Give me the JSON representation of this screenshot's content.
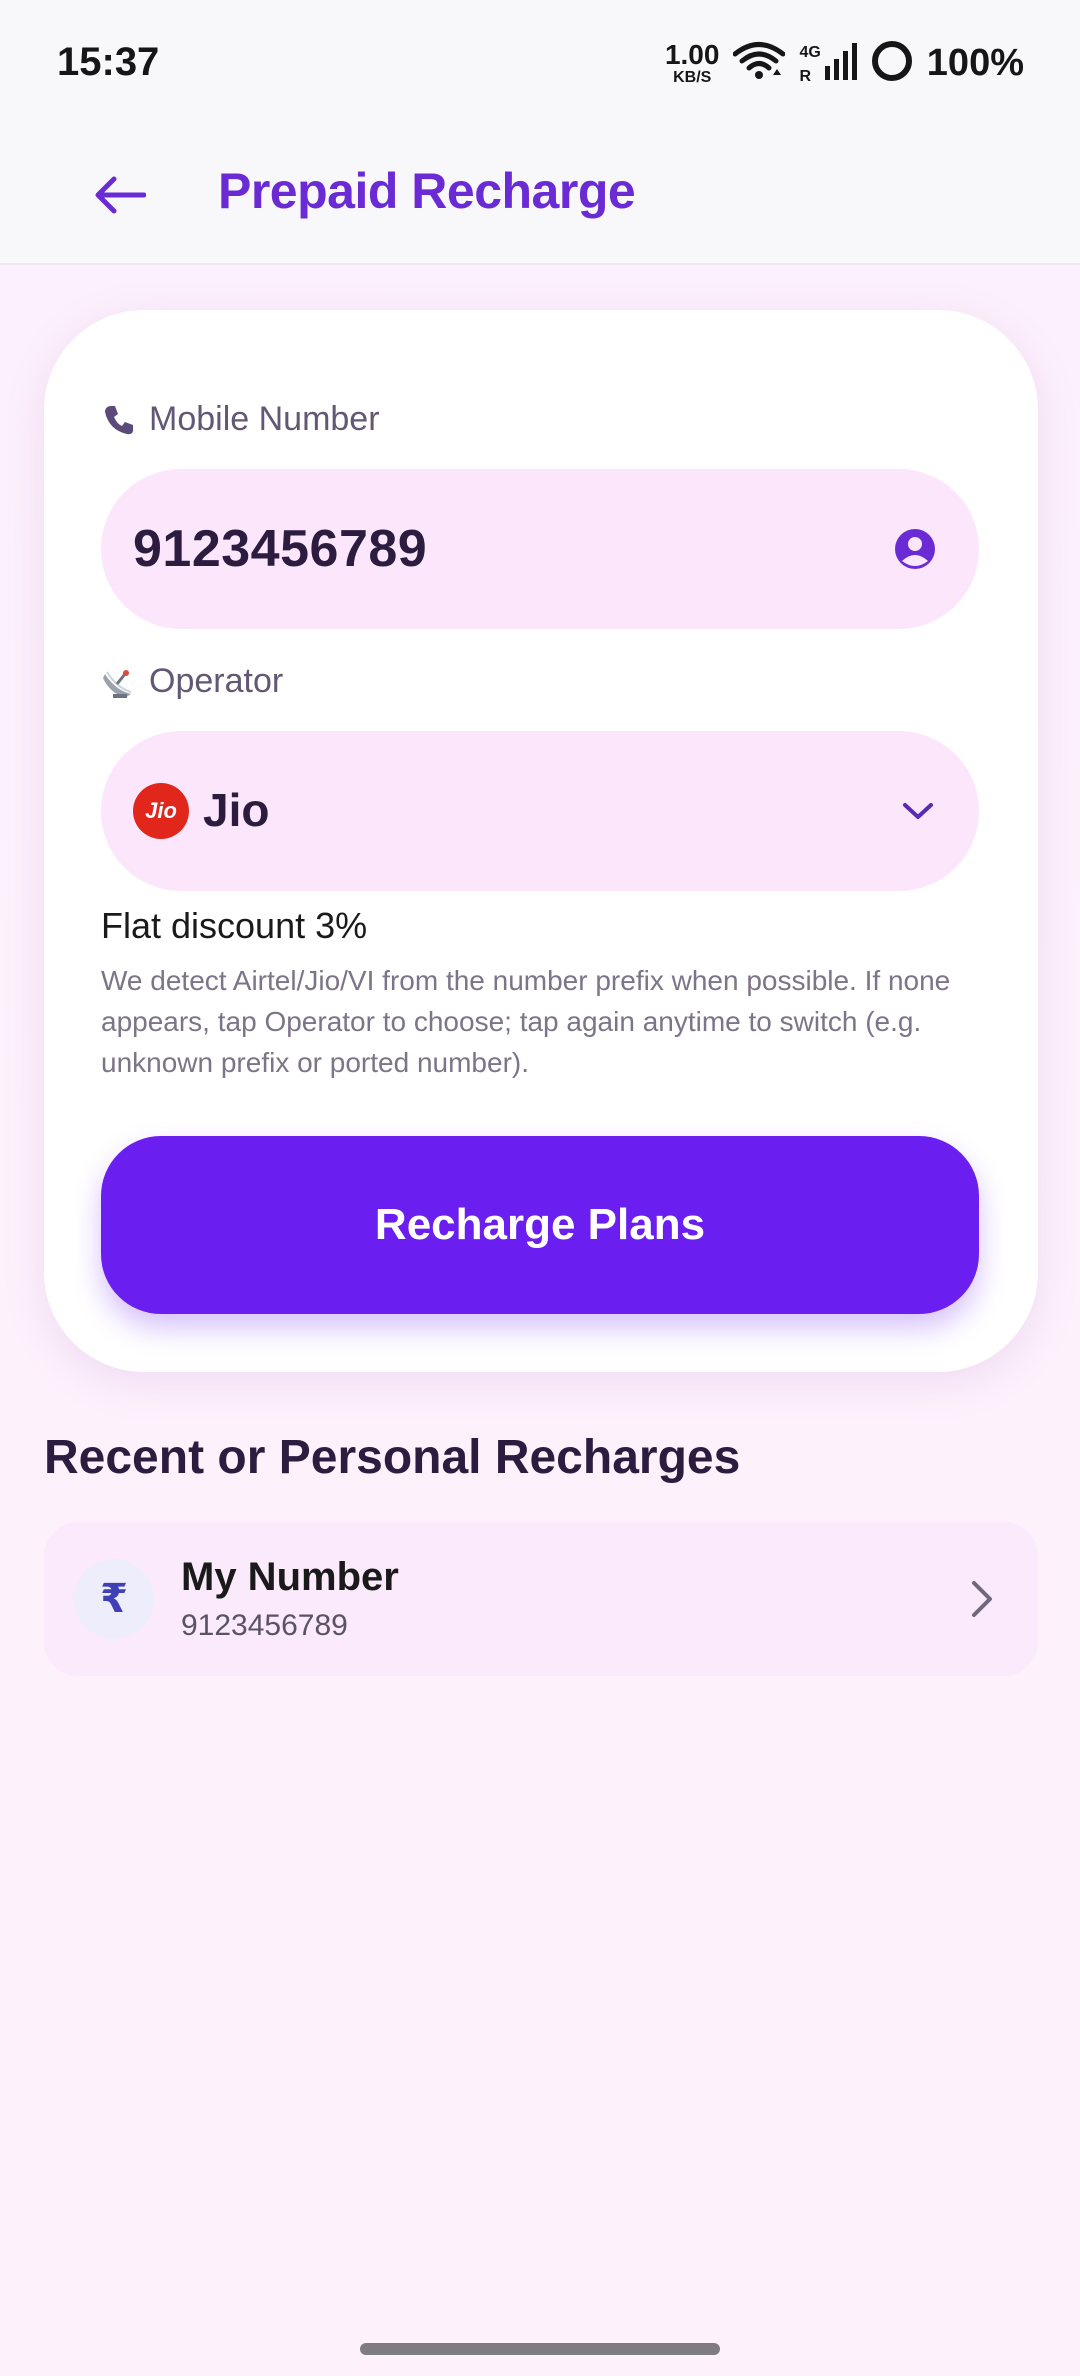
{
  "status_bar": {
    "time": "15:37",
    "speed_value": "1.00",
    "speed_unit": "KB/S",
    "network_type": "4G",
    "roaming": "R",
    "battery": "100%"
  },
  "app_bar": {
    "title": "Prepaid Recharge",
    "back_icon": "arrow-left-icon"
  },
  "form": {
    "mobile_label": "Mobile Number",
    "mobile_icon": "phone-icon",
    "mobile_value": "9123456789",
    "contact_icon": "contact-person-icon",
    "operator_label": "Operator",
    "operator_icon": "satellite-antenna-icon",
    "operator_logo_text": "Jio",
    "operator_value": "Jio",
    "discount": "Flat discount 3%",
    "helper": "We detect Airtel/Jio/VI from the number prefix when possible. If none appears, tap Operator to choose; tap again anytime to switch (e.g. unknown prefix or ported number).",
    "cta_label": "Recharge Plans"
  },
  "recent": {
    "section_title": "Recent or Personal Recharges",
    "items": [
      {
        "avatar_symbol": "₹",
        "name": "My Number",
        "number": "9123456789"
      }
    ]
  },
  "colors": {
    "accent": "#6a1ff0",
    "title": "#6a2bd4",
    "pill_bg": "#fbe6fb",
    "jio_red": "#e1261c"
  }
}
